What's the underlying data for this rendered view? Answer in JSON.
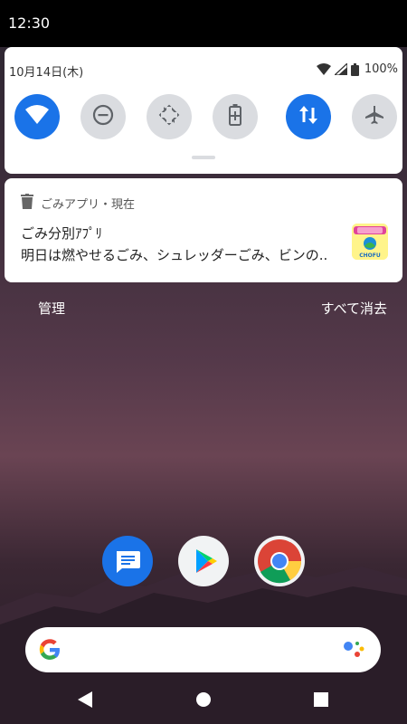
{
  "status_bar": {
    "time": "12:30"
  },
  "quick_settings": {
    "date": "10月14日(木)",
    "battery_percent": "100%",
    "tiles": [
      {
        "name": "wifi",
        "state": "on"
      },
      {
        "name": "do-not-disturb",
        "state": "off"
      },
      {
        "name": "auto-rotate",
        "state": "off"
      },
      {
        "name": "battery-saver",
        "state": "off"
      },
      {
        "name": "mobile-data",
        "state": "on"
      },
      {
        "name": "airplane-mode",
        "state": "off"
      }
    ]
  },
  "notification": {
    "app_time": "ごみアプリ・現在",
    "title": "ごみ分別ｱﾌﾟﾘ",
    "text": "明日は燃やせるごみ、シュレッダーごみ、ビンの..",
    "icon_caption": "CHOFU",
    "icon_header": "ごみアプリ"
  },
  "notification_actions": {
    "manage": "管理",
    "clear_all": "すべて消去"
  },
  "dock": [
    "messages-app",
    "play-store-app",
    "chrome-app"
  ],
  "colors": {
    "accent": "#1a73e8",
    "tile_off": "#dadce0"
  }
}
